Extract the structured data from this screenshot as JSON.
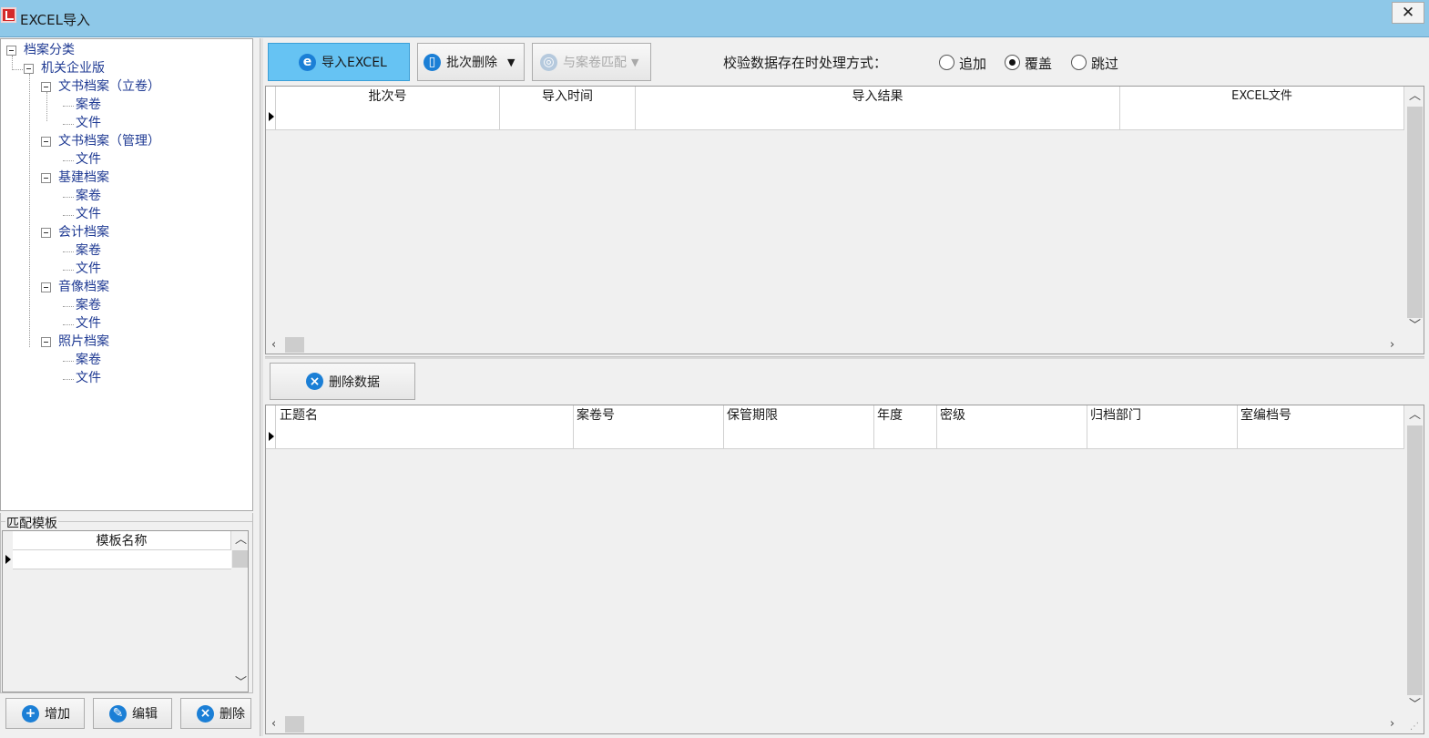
{
  "window": {
    "title": "EXCEL导入",
    "close_label": "✕"
  },
  "tree": {
    "root": "档案分类",
    "org": "机关企业版",
    "categories": [
      {
        "label": "文书档案（立卷）",
        "children": [
          "案卷",
          "文件"
        ]
      },
      {
        "label": "文书档案（管理）",
        "children": [
          "文件"
        ]
      },
      {
        "label": "基建档案",
        "children": [
          "案卷",
          "文件"
        ]
      },
      {
        "label": "会计档案",
        "children": [
          "案卷",
          "文件"
        ]
      },
      {
        "label": "音像档案",
        "children": [
          "案卷",
          "文件"
        ]
      },
      {
        "label": "照片档案",
        "children": [
          "案卷",
          "文件"
        ]
      }
    ]
  },
  "template_group": {
    "title": "匹配模板",
    "column": "模板名称",
    "buttons": {
      "add": "增加",
      "edit": "编辑",
      "delete": "删除"
    }
  },
  "toolbar": {
    "import_label": "导入EXCEL",
    "batch_delete_label": "批次删除",
    "match_label": "与案卷匹配",
    "check_label": "校验数据存在时处理方式：",
    "radio_options": [
      "追加",
      "覆盖",
      "跳过"
    ],
    "radio_selected": "覆盖"
  },
  "batch_grid": {
    "columns": [
      "批次号",
      "导入时间",
      "导入结果",
      "EXCEL文件"
    ]
  },
  "data_section": {
    "delete_label": "删除数据",
    "columns": [
      "正题名",
      "案卷号",
      "保管期限",
      "年度",
      "密级",
      "归档部门",
      "室编档号"
    ]
  },
  "colors": {
    "title_bar": "#8ec8e8",
    "accent": "#1b7fd6",
    "primary_button": "#66c3f3"
  },
  "icons": {
    "import": "excel-icon",
    "batch_delete": "trash-icon",
    "match": "globe-icon",
    "delete_data": "x-circle-icon",
    "add": "plus-circle-icon",
    "edit": "pencil-icon",
    "delete": "x-circle-icon"
  }
}
